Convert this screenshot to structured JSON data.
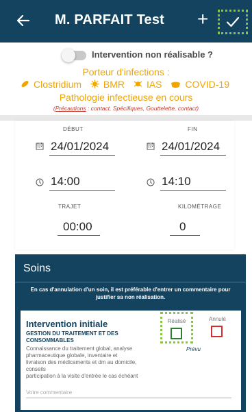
{
  "header": {
    "title": "M. PARFAIT Test",
    "plus": "+"
  },
  "intervention": {
    "toggle_label": "Intervention non réalisable ?",
    "toggle_on": false
  },
  "infections": {
    "heading": "Porteur d'infections :",
    "items": [
      "Clostridium",
      "BMR",
      "IAS",
      "COVID-19"
    ],
    "pathology": "Pathologie infectieuse en cours",
    "precautions_label": "Précautions",
    "precautions_text": " : contact, Spécifiques, Gouttelette, contact)",
    "precautions_open": "(",
    "color": "#f0a500"
  },
  "dates": {
    "debut_label": "DÉBUT",
    "fin_label": "FIN",
    "debut_date": "24/01/2024",
    "fin_date": "24/01/2024",
    "debut_time": "14:00",
    "fin_time": "14:10",
    "trajet_label": "TRAJET",
    "trajet_value": "00:00",
    "km_label": "KILOMÉTRAGE",
    "km_value": "0"
  },
  "soins": {
    "title": "Soins",
    "note": "En cas d'annulation d'un soin, il est préférable d'entrer un commentaire pour justifier sa non réalisation.",
    "card": {
      "title": "Intervention initiale",
      "subtitle": "GESTION DU TRAITEMENT ET DES CONSOMMABLES",
      "desc_lines": [
        "Connaissance du traitement global, analyse",
        "pharmaceutique globale, inventaire et",
        "livraison des médicaments et dm au domicile,",
        "conseils",
        "participation à la visite d'entrée le cas échéant"
      ],
      "realise_label": "Réalisé",
      "annule_label": "Annulé",
      "prevu_label": "Prévu",
      "comment_placeholder": "Votre commentaire"
    }
  },
  "colors": {
    "primary": "#14435f",
    "accent": "#f0a500",
    "highlight": "#8bc34a"
  }
}
